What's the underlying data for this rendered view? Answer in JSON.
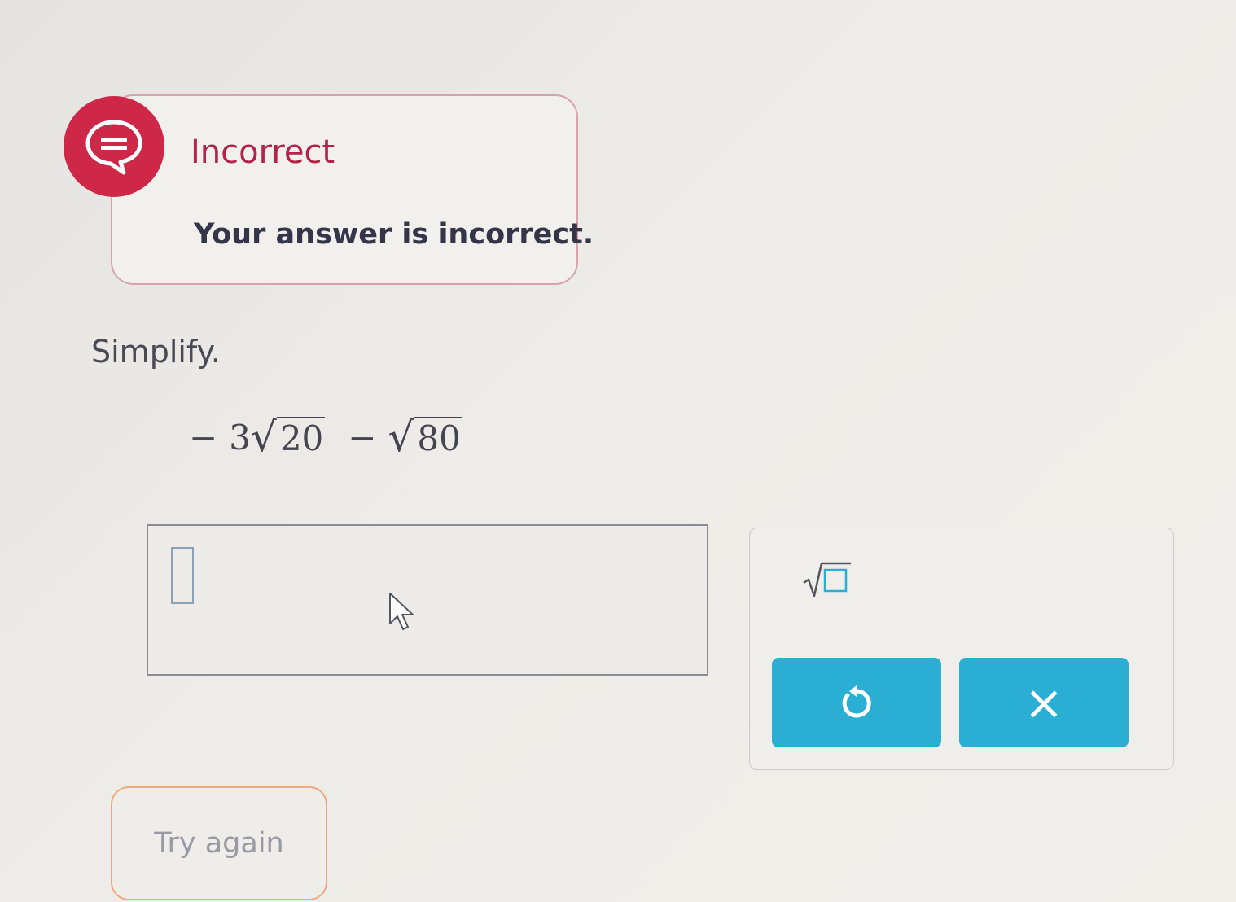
{
  "feedback": {
    "status_icon": "speech-bubble-icon",
    "title": "Incorrect",
    "message": "Your answer is incorrect.",
    "accent_color": "#cf2748"
  },
  "question": {
    "instruction": "Simplify.",
    "expression": {
      "term1_sign": "−",
      "term1_coefficient": "3",
      "term1_radicand": "20",
      "operator": "−",
      "term2_radicand": "80"
    }
  },
  "answer": {
    "value": ""
  },
  "keypad": {
    "sqrt_key_icon": "square-root-template-icon",
    "undo_icon": "undo-icon",
    "clear_icon": "close-icon",
    "clear_glyph": "×",
    "button_color": "#2aaed4"
  },
  "actions": {
    "try_again_label": "Try again",
    "try_again_border_color": "#f0a77e"
  }
}
